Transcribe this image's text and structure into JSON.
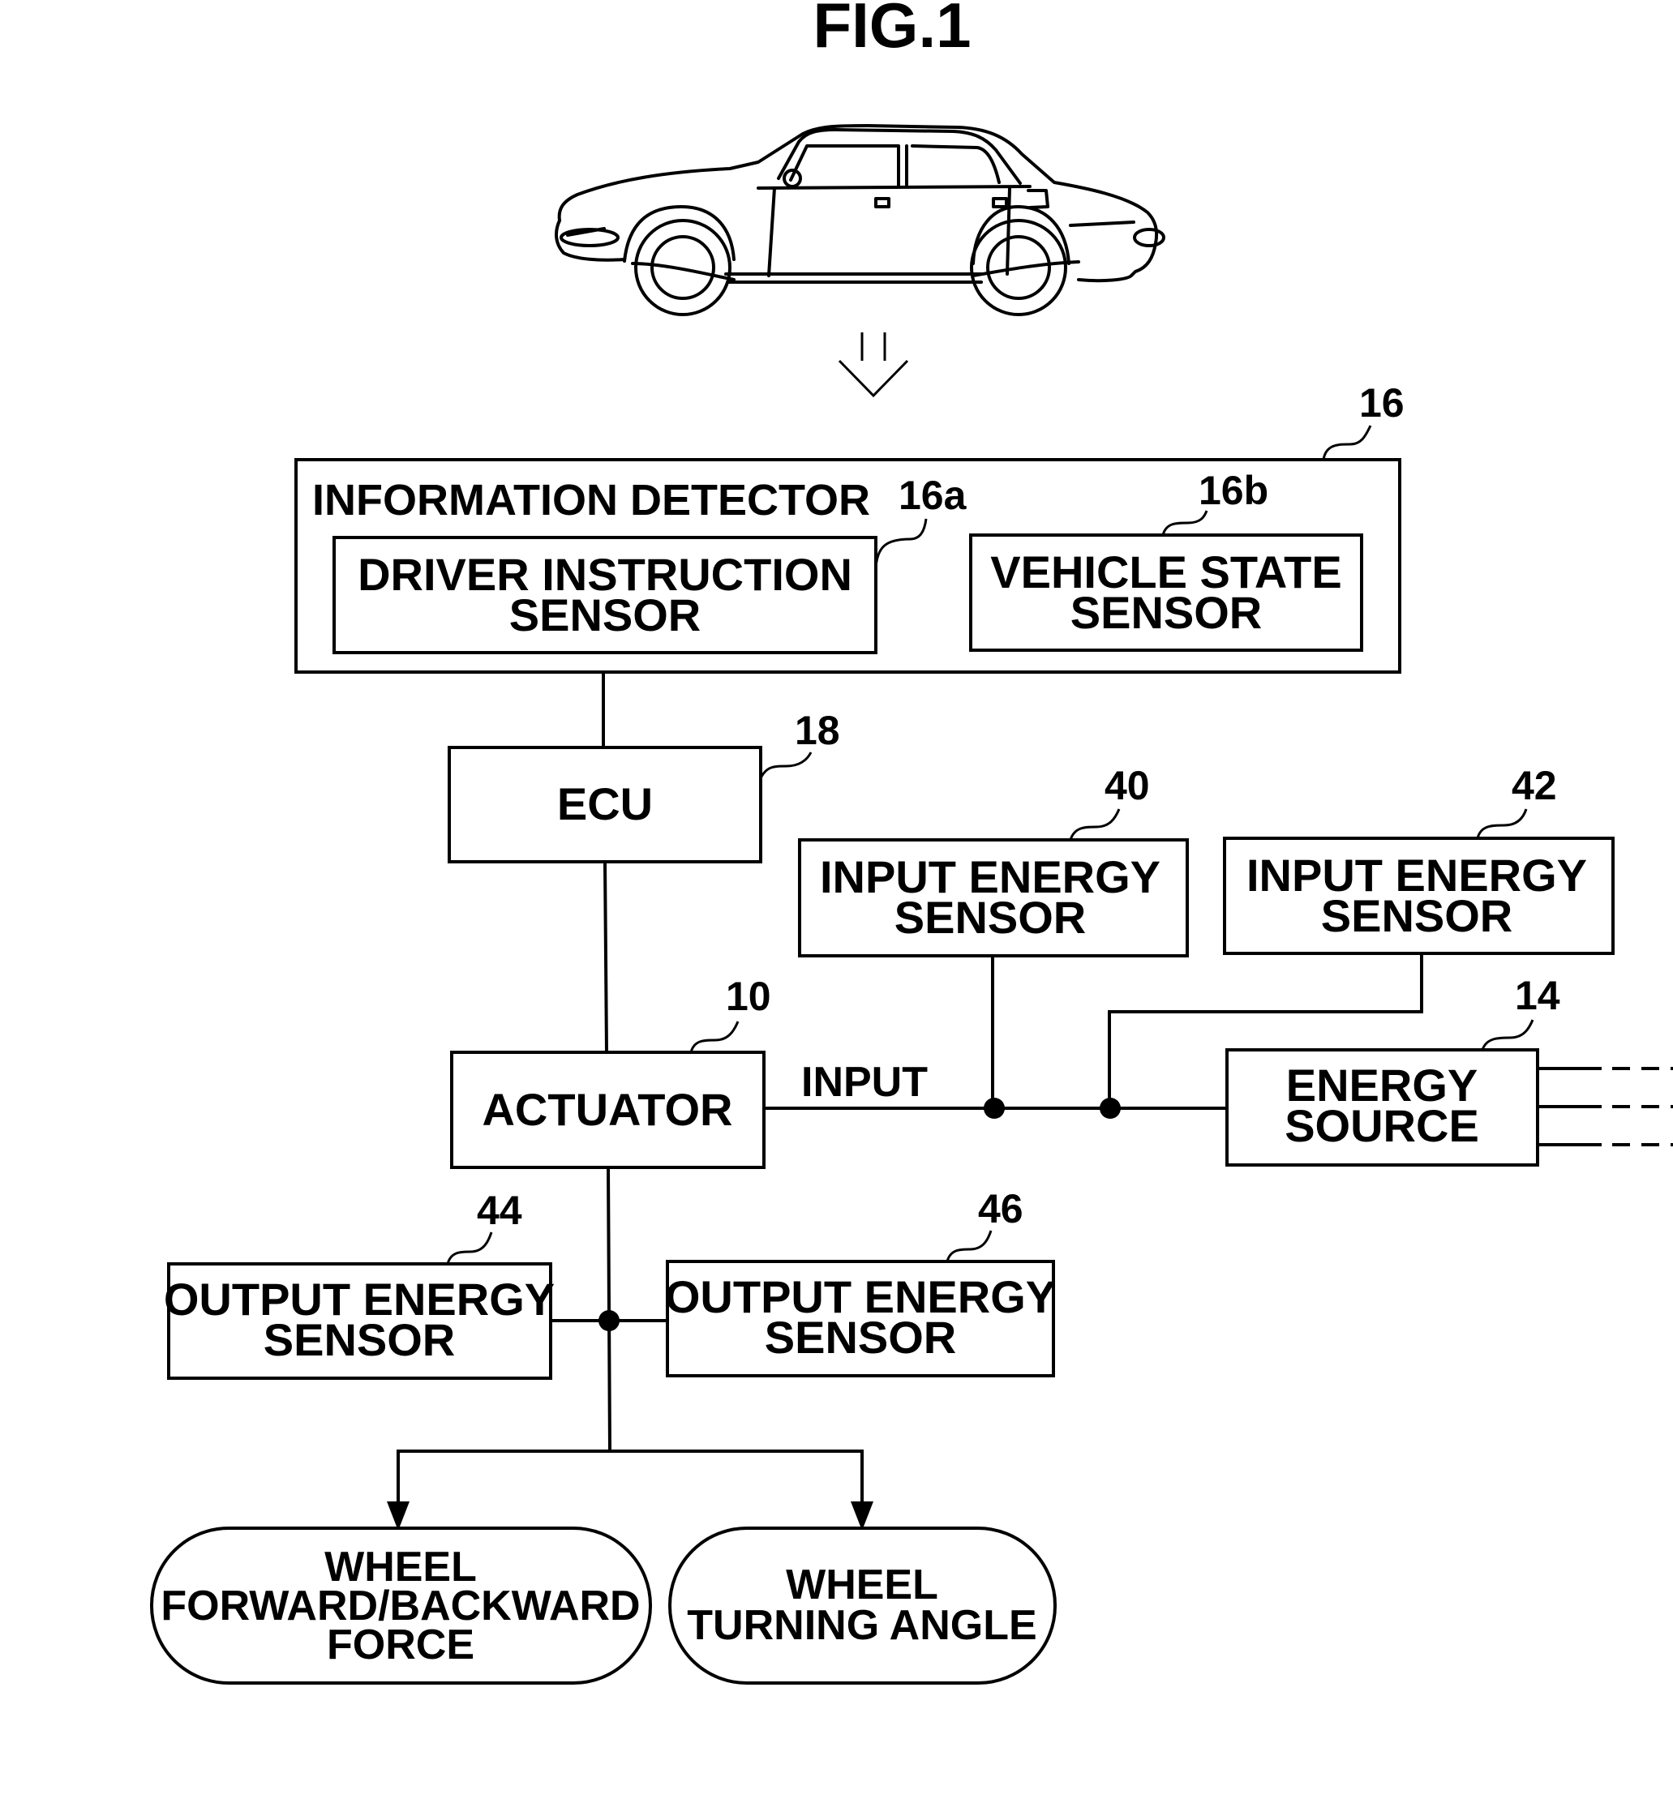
{
  "figure": {
    "title": "FIG.1"
  },
  "car": {
    "icon": "car-icon",
    "flow_arrow": "double-down-arrow-icon"
  },
  "blocks": {
    "info_detector": {
      "ref": "16",
      "label": "INFORMATION DETECTOR"
    },
    "driver_sensor": {
      "ref": "16a",
      "line1": "DRIVER INSTRUCTION",
      "line2": "SENSOR"
    },
    "vehicle_sensor": {
      "ref": "16b",
      "line1": "VEHICLE STATE",
      "line2": "SENSOR"
    },
    "ecu": {
      "ref": "18",
      "label": "ECU"
    },
    "input_sensor_40": {
      "ref": "40",
      "line1": "INPUT ENERGY",
      "line2": "SENSOR"
    },
    "input_sensor_42": {
      "ref": "42",
      "line1": "INPUT ENERGY",
      "line2": "SENSOR"
    },
    "actuator": {
      "ref": "10",
      "label": "ACTUATOR"
    },
    "energy_source": {
      "ref": "14",
      "line1": "ENERGY",
      "line2": "SOURCE"
    },
    "output_sensor_44": {
      "ref": "44",
      "line1": "OUTPUT ENERGY",
      "line2": "SENSOR"
    },
    "output_sensor_46": {
      "ref": "46",
      "line1": "OUTPUT ENERGY",
      "line2": "SENSOR"
    },
    "wheel_force": {
      "line1": "WHEEL",
      "line2": "FORWARD/BACKWARD",
      "line3": "FORCE"
    },
    "wheel_angle": {
      "line1": "WHEEL",
      "line2": "TURNING ANGLE"
    }
  },
  "connections": {
    "input_label": "INPUT"
  }
}
